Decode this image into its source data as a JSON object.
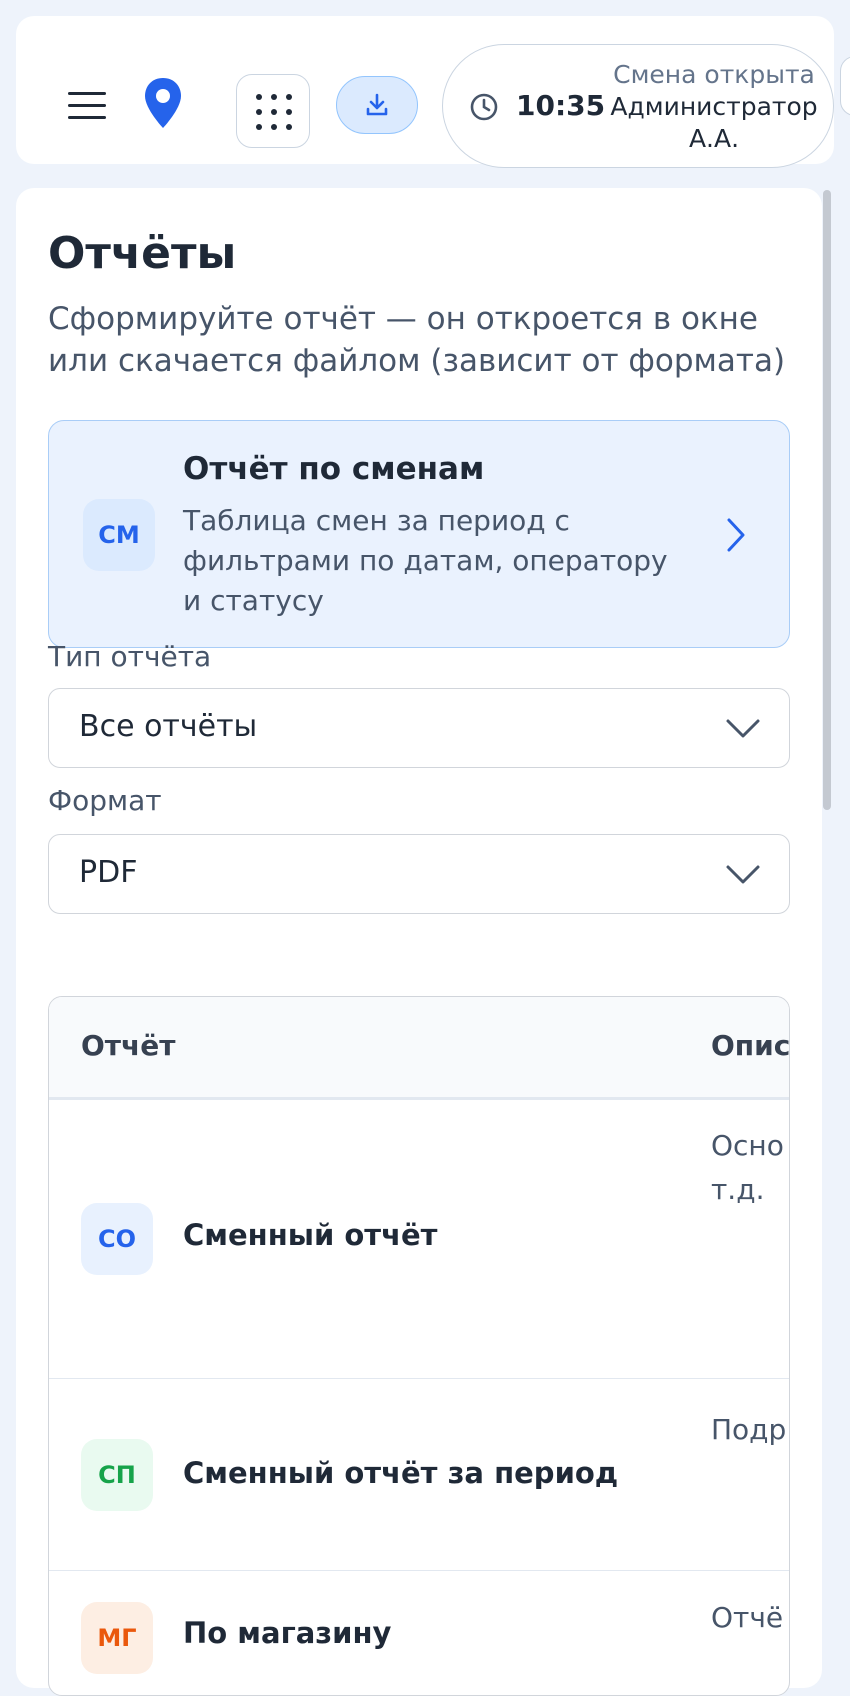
{
  "header": {
    "time": "10:35",
    "shift_status": "Смена открыта",
    "user_name": "Администратор А.А."
  },
  "page": {
    "title": "Отчёты",
    "subtitle": "Сформируйте отчёт — он откроется в окне или скачается файлом (зависит от формата)"
  },
  "featured_report": {
    "badge": "СМ",
    "title": "Отчёт по сменам",
    "description": "Таблица смен за период с фильтрами по датам, оператору и статусу"
  },
  "filters": {
    "report_type_label": "Тип отчёта",
    "report_type_value": "Все отчёты",
    "format_label": "Формат",
    "format_value": "PDF"
  },
  "table": {
    "columns": [
      "Отчёт",
      "Опис"
    ],
    "rows": [
      {
        "badge": "СО",
        "name": "Сменный отчёт",
        "description": "Осно итога выру топли т.д."
      },
      {
        "badge": "СП",
        "name": "Сменный отчёт за период",
        "description": "Подр всем выбр"
      },
      {
        "badge": "МГ",
        "name": "По магазину",
        "description": "Отчё"
      }
    ]
  },
  "colors": {
    "accent": "#2563eb",
    "badge_green": "#16a34a",
    "badge_orange": "#ea580c",
    "feature_bg": "#eaf2fe"
  },
  "icons": [
    "menu-icon",
    "location-pin-icon",
    "apps-grid-icon",
    "download-icon",
    "clock-icon",
    "chevron-right-icon",
    "chevron-down-icon"
  ]
}
